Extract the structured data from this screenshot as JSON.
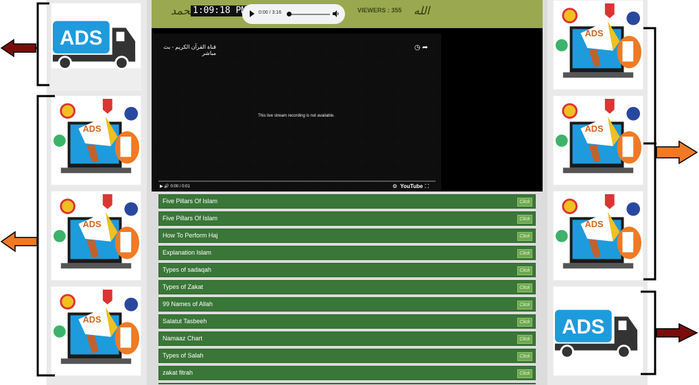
{
  "colors": {
    "topbar": "#9aa84f",
    "menu_green": "#3a7638",
    "click_green": "#6ea850",
    "arrow_dark_red": "#7a0c0c",
    "arrow_orange": "#f07a24",
    "ads_blue": "#1e9bdc"
  },
  "topbar": {
    "calligraphy_left": "محمد",
    "clock": "1:09:18 PM",
    "audio_time": "0:00 / 3:16",
    "viewers": "VIEWERS : 355",
    "calligraphy_right": "الله"
  },
  "video": {
    "title": "قناة القرآن الكريم - بث مباشر",
    "message": "This live stream recording is not available.",
    "time": "0:00 / 0:01",
    "brand": "YouTube"
  },
  "menu": {
    "click_label": "Click",
    "items": [
      "Five Pillars Of Islam",
      "Five Pillars Of Islam",
      "How To Perform Haj",
      "Explanation Islam",
      "Types of sadaqah",
      "Types of Zakat",
      "99 Names of Allah",
      "Salatut Tasbeeh",
      "Namaaz Chart",
      "Types of Salah",
      "zakat fitrah"
    ]
  },
  "ads": {
    "label": "ADS"
  }
}
